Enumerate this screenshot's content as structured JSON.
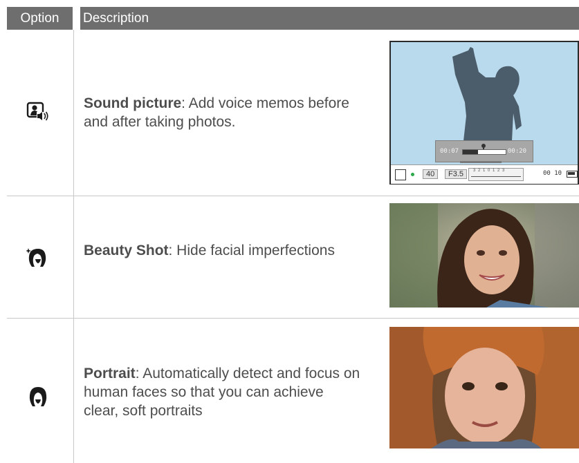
{
  "header": {
    "option": "Option",
    "description": "Description"
  },
  "rows": [
    {
      "icon": "sound-picture-icon",
      "title": "Sound picture",
      "text": ": Add voice memos before and after taking photos.",
      "screen": {
        "time_start": "00:07",
        "time_end": "00:20",
        "iso": "40",
        "aperture": "F3.5",
        "exposure_scale": "3 2 1 0 1 2 3",
        "shots": "00 10"
      }
    },
    {
      "icon": "beauty-shot-icon",
      "title": "Beauty Shot",
      "text": ": Hide facial imperfections"
    },
    {
      "icon": "portrait-icon",
      "title": "Portrait",
      "text": ": Automatically detect and focus on human faces so that you can achieve clear, soft portraits"
    }
  ]
}
